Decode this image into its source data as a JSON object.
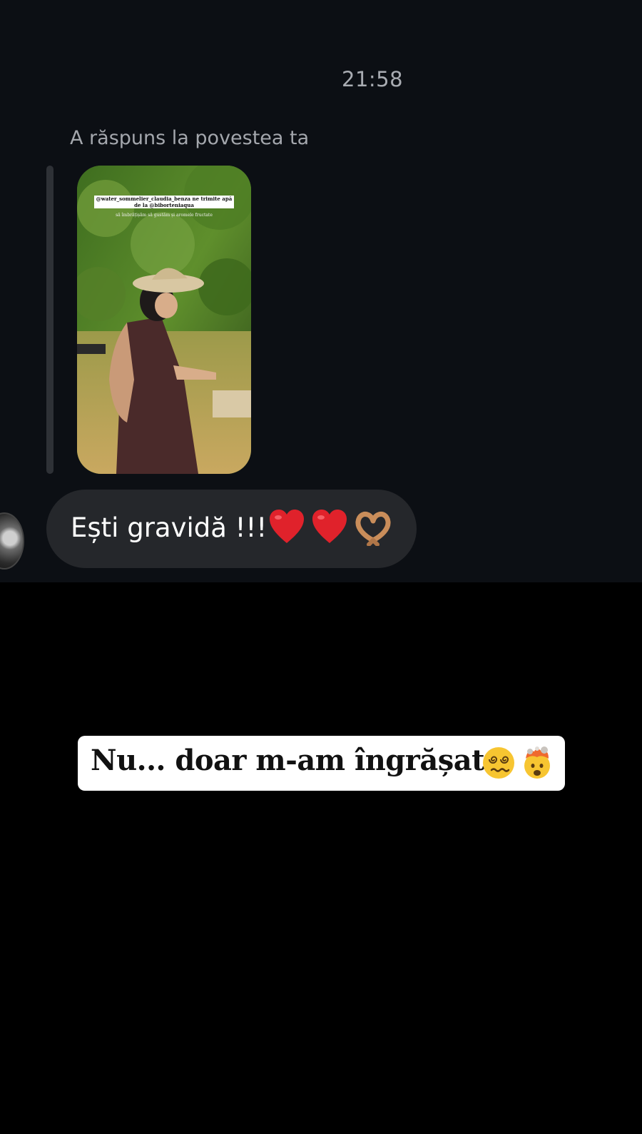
{
  "chat": {
    "timestamp": "21:58",
    "reply_label": "A răspuns la povestea ta",
    "story_preview": {
      "caption_line1": "@water_sommelier_claudia_benza ne trimite apă de la @biborteniaqua",
      "caption_line2": "să îmbrățișăm să gustăm și aromele fructate"
    },
    "message": {
      "text": "Ești gravidă !!!",
      "emojis": [
        "red-heart",
        "red-heart",
        "heart-hands"
      ]
    }
  },
  "overlay": {
    "text": "Nu... doar m-am îngrășat",
    "emojis": [
      "face-with-spiral-eyes",
      "exploding-head"
    ]
  },
  "colors": {
    "chat_background": "#0c0f14",
    "bubble": "#25272b",
    "page_background": "#000000",
    "sticker_background": "#ffffff"
  }
}
